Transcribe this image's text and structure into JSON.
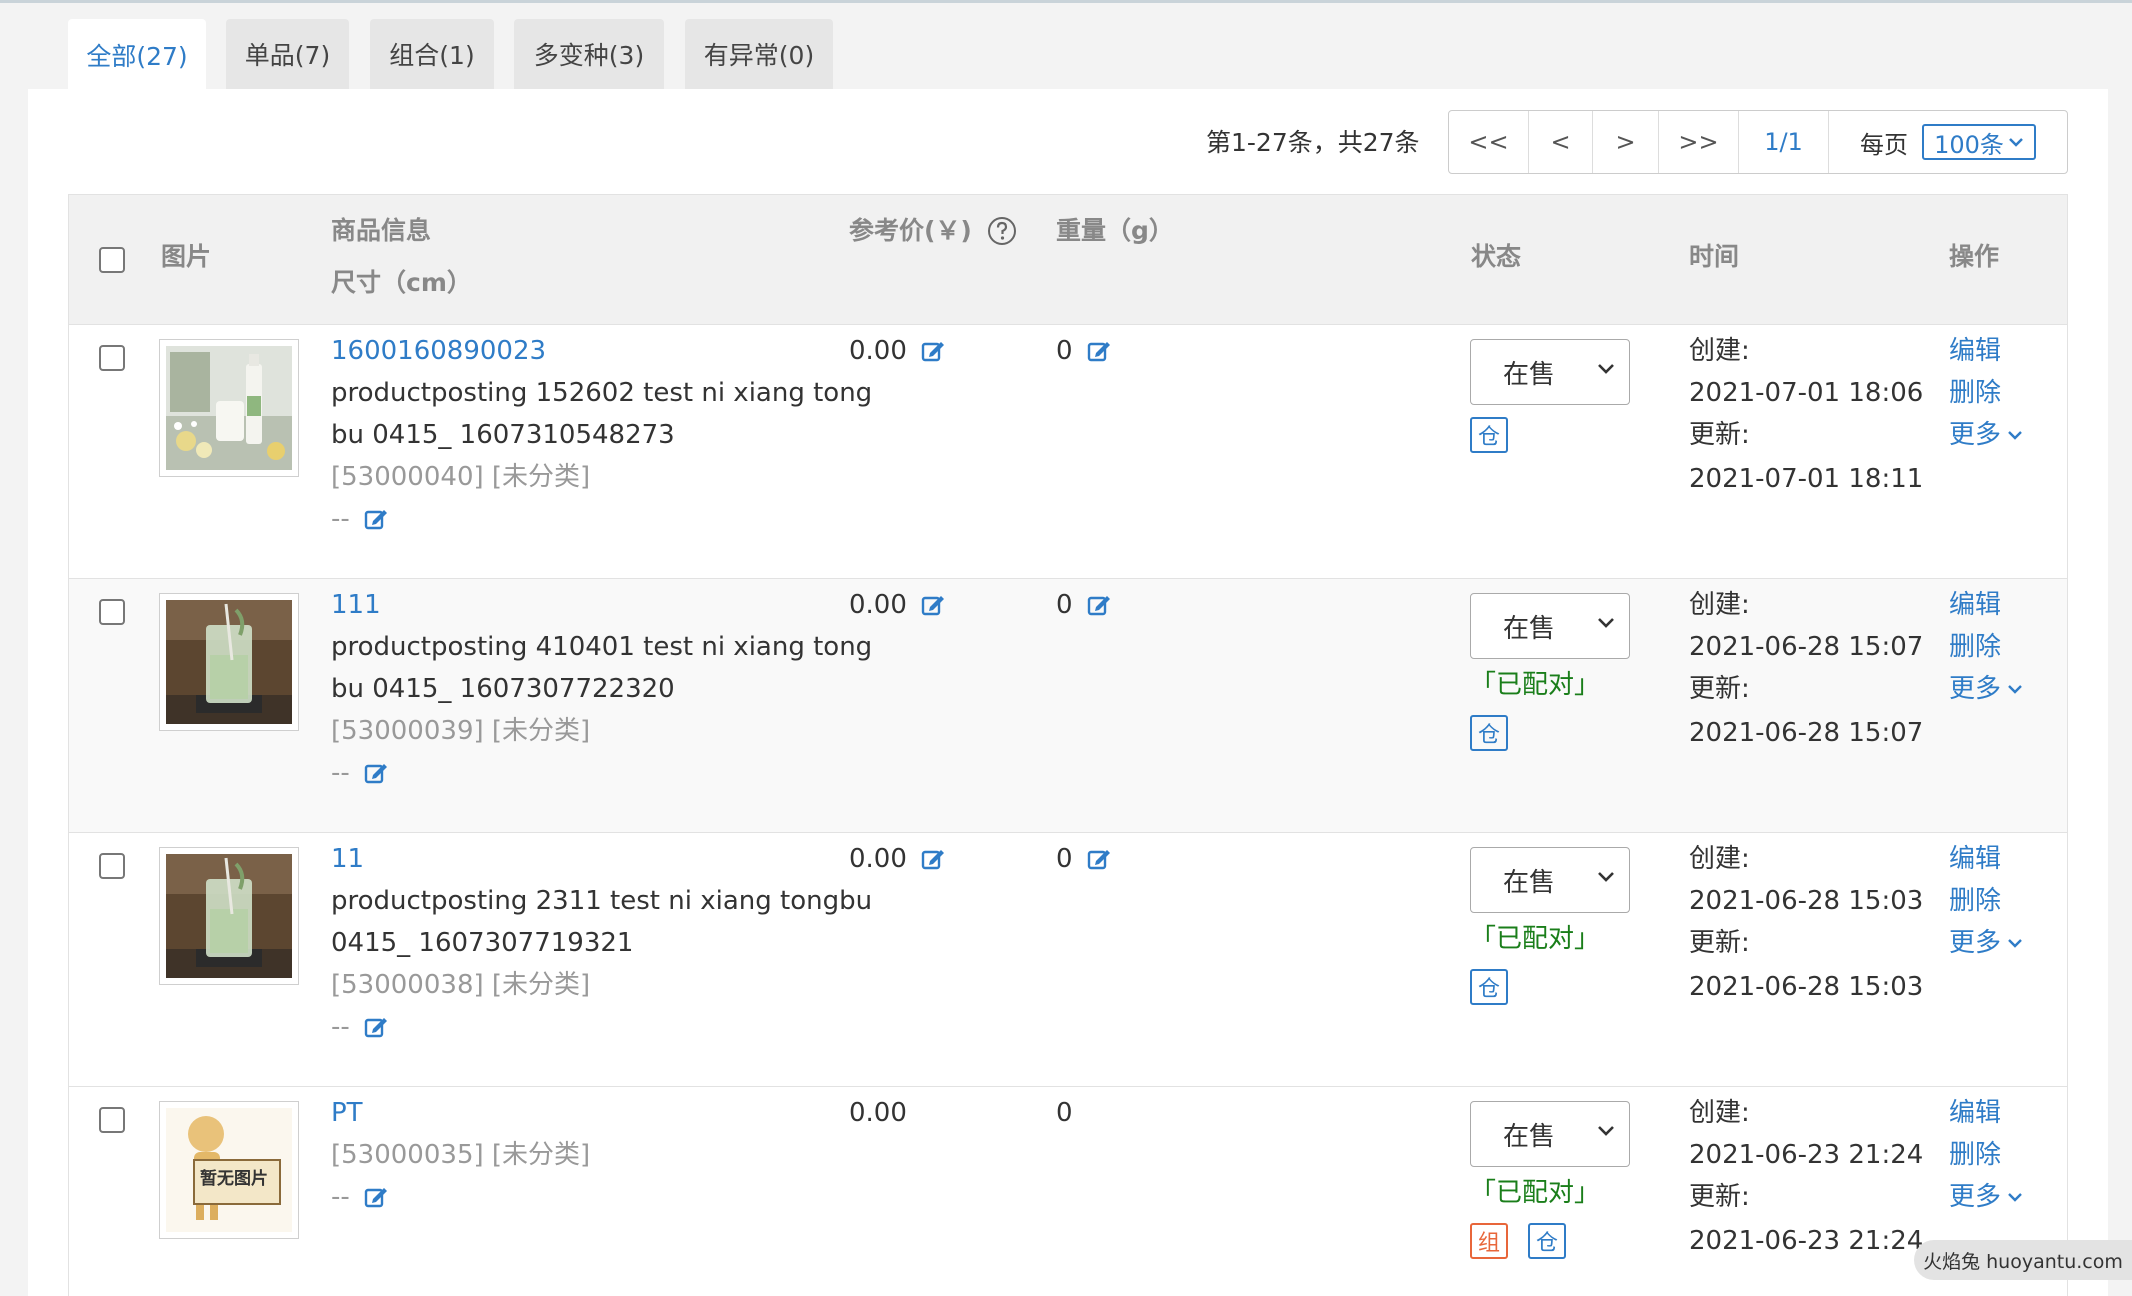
{
  "tabs": [
    {
      "label": "全部(27)",
      "active": true
    },
    {
      "label": "单品(7)"
    },
    {
      "label": "组合(1)"
    },
    {
      "label": "多变种(3)"
    },
    {
      "label": "有异常(0)"
    }
  ],
  "pagination": {
    "summary": "第1-27条，共27条",
    "first": "<<",
    "prev": "<",
    "next": ">",
    "last": ">>",
    "page": "1/1",
    "per_page_label": "每页",
    "per_page_value": "100条"
  },
  "columns": {
    "image": "图片",
    "info": "商品信息",
    "size": "尺寸（cm）",
    "price": "参考价(￥)",
    "weight": "重量（g）",
    "status": "状态",
    "time": "时间",
    "action": "操作"
  },
  "labels": {
    "created": "创建:",
    "updated": "更新:",
    "edit": "编辑",
    "delete": "删除",
    "more": "更多",
    "paired": "「已配对」",
    "status_on_sale": "在售",
    "warehouse_badge": "仓",
    "combo_badge": "组",
    "no_image": "暂无图片"
  },
  "products": [
    {
      "title": "1600160890023",
      "desc1": "productposting 152602 test ni xiang tong",
      "desc2": "bu 0415_ 1607310548273",
      "code": "[53000040] [未分类]",
      "dims": "--",
      "price": "0.00",
      "weight": "0",
      "created": "2021-07-01 18:06",
      "updated": "2021-07-01 18:11",
      "paired": false,
      "image": "bottle-photo"
    },
    {
      "title": "111",
      "desc1": "productposting 410401 test ni xiang tong",
      "desc2": "bu 0415_ 1607307722320",
      "code": "[53000039] [未分类]",
      "dims": "--",
      "price": "0.00",
      "weight": "0",
      "created": "2021-06-28 15:07",
      "updated": "2021-06-28 15:07",
      "paired": true,
      "image": "drink-glass-photo"
    },
    {
      "title": "11",
      "desc1": "productposting 2311 test ni xiang tongbu",
      "desc2": "0415_ 1607307719321",
      "code": "[53000038] [未分类]",
      "dims": "--",
      "price": "0.00",
      "weight": "0",
      "created": "2021-06-28 15:03",
      "updated": "2021-06-28 15:03",
      "paired": true,
      "image": "drink-glass-photo"
    },
    {
      "title": "PT",
      "code": "[53000035] [未分类]",
      "dims": "--",
      "price": "0.00",
      "weight": "0",
      "created": "2021-06-23 21:24",
      "updated": "2021-06-23 21:24",
      "paired": true,
      "image": "no-image-placeholder"
    }
  ],
  "watermark": "火焰兔 huoyantu.com",
  "colors": {
    "link": "#2f7cc7",
    "paired": "#1a7e1a",
    "combo": "#e8663a"
  }
}
